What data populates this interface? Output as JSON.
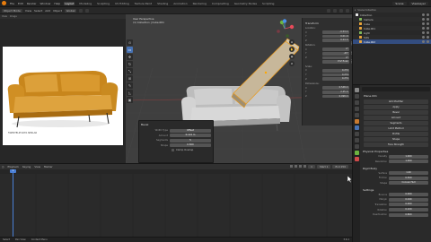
{
  "topbar": {
    "menus": [
      "File",
      "Edit",
      "Render",
      "Window",
      "Help"
    ],
    "workspaces": [
      "Layout",
      "Modeling",
      "Sculpting",
      "UV Editing",
      "Texture Paint",
      "Shading",
      "Animation",
      "Rendering",
      "Compositing",
      "Geometry Nodes",
      "Scripting"
    ],
    "active_workspace": "Layout",
    "scene": "Scene",
    "view_layer": "ViewLayer"
  },
  "viewport_header": {
    "mode": "Object Mode",
    "menus": [
      "View",
      "Select",
      "Add",
      "Object"
    ],
    "orientation": "Global"
  },
  "ref_panel": {
    "tabs": [
      "View",
      "Image"
    ],
    "caption": "5WESTELM SOFA SIMILAR"
  },
  "viewport": {
    "info_line1": "User Perspective",
    "info_line2": "(1) Collection | Cube.001",
    "tools": [
      "cursor",
      "move",
      "rotate",
      "scale",
      "transform",
      "annotate",
      "measure",
      "add-cube"
    ],
    "nav": [
      "+",
      "-",
      "hand",
      "camera",
      "grid"
    ]
  },
  "npanel": {
    "title": "Transform",
    "location_label": "Location:",
    "location": [
      {
        "axis": "X",
        "value": "-0.53 m"
      },
      {
        "axis": "Y",
        "value": "0.01 m"
      },
      {
        "axis": "Z",
        "value": "0.24 m"
      }
    ],
    "rotation_label": "Rotation:",
    "rotation": [
      {
        "axis": "X",
        "value": "0°"
      },
      {
        "axis": "Y",
        "value": "-45°"
      },
      {
        "axis": "Z",
        "value": "0°"
      }
    ],
    "mode": "XYZ Euler",
    "scale_label": "Scale:",
    "scale": [
      {
        "axis": "X",
        "value": "0.274"
      },
      {
        "axis": "Y",
        "value": "0.274"
      },
      {
        "axis": "Z",
        "value": "0.274"
      }
    ],
    "dims_label": "Dimensions:",
    "dims": [
      {
        "axis": "X",
        "value": "0.548 m"
      },
      {
        "axis": "Y",
        "value": "2.25 m"
      },
      {
        "axis": "Z",
        "value": "0.098 m"
      }
    ],
    "tabs": [
      "Item",
      "Tool",
      "View"
    ]
  },
  "op_dialog": {
    "title": "Bevel",
    "rows": [
      {
        "label": "Width Type",
        "value": "Offset"
      },
      {
        "label": "Amount",
        "value": "0.124 m"
      },
      {
        "label": "Segments",
        "value": "5"
      },
      {
        "label": "Shape",
        "value": "0.500"
      }
    ],
    "checkbox_label": "Clamp Overlap"
  },
  "outliner": {
    "title": "Scene Collection",
    "items": [
      {
        "name": "Collection",
        "color": "#e8e8e8",
        "depth": 0
      },
      {
        "name": "Camera",
        "color": "#7fb85a",
        "depth": 1
      },
      {
        "name": "Cube",
        "color": "#e8a43a",
        "depth": 1
      },
      {
        "name": "Cube.001",
        "color": "#e8a43a",
        "depth": 1
      },
      {
        "name": "Light",
        "color": "#7fb85a",
        "depth": 1
      },
      {
        "name": "Sofa",
        "color": "#e8a43a",
        "depth": 1
      },
      {
        "name": "Cube.002",
        "color": "#e8a43a",
        "depth": 1,
        "selected": true
      }
    ]
  },
  "properties": {
    "object_name": "Plane.001",
    "buttons": [
      "Add Modifier",
      "Apply",
      "Bevel",
      "Amount",
      "Segments",
      "Limit Method",
      "Profile",
      "Shape",
      "Face Strength"
    ],
    "section1": "Physical Properties",
    "rows1": [
      {
        "label": "Density",
        "value": "1.000"
      },
      {
        "label": "Resolution",
        "value": "1.000"
      }
    ],
    "section2": "Rigid Body",
    "rows2": [
      {
        "label": "Surface",
        "value": "1.00"
      },
      {
        "label": "Friction",
        "value": "0.500"
      },
      {
        "label": "Shape",
        "value": "Convex Hull"
      }
    ],
    "section3": "Settings",
    "rows3": [
      {
        "label": "Bounce",
        "value": "0.000"
      },
      {
        "label": "Margin",
        "value": "0.040"
      },
      {
        "label": "Translation",
        "value": "0.000"
      },
      {
        "label": "Rotation",
        "value": "0.100"
      },
      {
        "label": "Deactivation",
        "value": "0.800"
      }
    ]
  },
  "timeline": {
    "menus": [
      "Playback",
      "Keying",
      "View",
      "Marker"
    ],
    "current_frame": "1",
    "start": "Start 1",
    "end": "End 250"
  },
  "statusbar": {
    "items": [
      "Select",
      "Pan View",
      "Context Menu"
    ],
    "version": "3.6.1"
  },
  "colors": {
    "accent": "#4772b3",
    "sofa_ref": "#d89a2a",
    "viewport_bg": "#3f3f3f"
  }
}
